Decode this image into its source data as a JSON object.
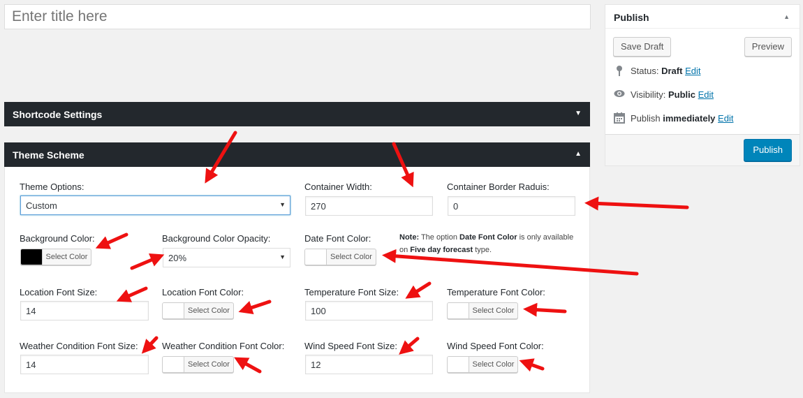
{
  "title_field": {
    "placeholder": "Enter title here"
  },
  "sections": {
    "shortcode_settings": "Shortcode Settings",
    "theme_scheme": "Theme Scheme"
  },
  "fields": {
    "theme_options": {
      "label": "Theme Options:",
      "value": "Custom"
    },
    "container_width": {
      "label": "Container Width:",
      "value": "270"
    },
    "container_border_radius": {
      "label": "Container Border Raduis:",
      "value": "0"
    },
    "background_color": {
      "label": "Background Color:",
      "button": "Select Color",
      "swatch": "#000000"
    },
    "background_color_opacity": {
      "label": "Background Color Opacity:",
      "value": "20%"
    },
    "date_font_color": {
      "label": "Date Font Color:",
      "button": "Select Color",
      "swatch": "#ffffff"
    },
    "location_font_size": {
      "label": "Location Font Size:",
      "value": "14"
    },
    "location_font_color": {
      "label": "Location Font Color:",
      "button": "Select Color",
      "swatch": "#ffffff"
    },
    "temperature_font_size": {
      "label": "Temperature Font Size:",
      "value": "100"
    },
    "temperature_font_color": {
      "label": "Temperature Font Color:",
      "button": "Select Color",
      "swatch": "#ffffff"
    },
    "weather_condition_font_size": {
      "label": "Weather Condition Font Size:",
      "value": "14"
    },
    "weather_condition_font_color": {
      "label": "Weather Condition Font Color:",
      "button": "Select Color",
      "swatch": "#ffffff"
    },
    "wind_speed_font_size": {
      "label": "Wind Speed Font Size:",
      "value": "12"
    },
    "wind_speed_font_color": {
      "label": "Wind Speed Font Color:",
      "button": "Select Color",
      "swatch": "#ffffff"
    }
  },
  "note": {
    "prefix": "Note:",
    "text1": " The option ",
    "highlight1": "Date Font Color",
    "text2": " is only available on ",
    "highlight2": "Five day forecast",
    "text3": " type."
  },
  "publish": {
    "title": "Publish",
    "save_draft": "Save Draft",
    "preview": "Preview",
    "status_label": "Status:",
    "status_value": "Draft",
    "visibility_label": "Visibility:",
    "visibility_value": "Public",
    "publish_label": "Publish",
    "publish_value": "immediately",
    "edit": "Edit",
    "publish_button": "Publish"
  },
  "colors": {
    "accent": "#0085ba",
    "dark_bar": "#23282d",
    "annotation_arrow": "#ee1111"
  },
  "icons": [
    "caret-down-icon",
    "caret-up-icon",
    "pin-icon",
    "eye-icon",
    "calendar-icon",
    "red-arrow-annotation"
  ]
}
